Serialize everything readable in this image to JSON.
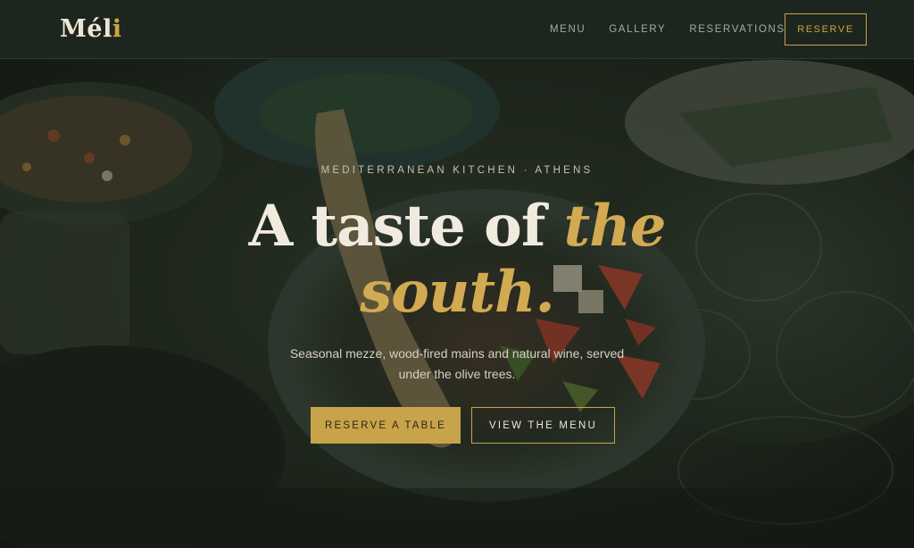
{
  "brand": {
    "logo_main": "Mél",
    "logo_accent": "i"
  },
  "nav": {
    "items": [
      {
        "label": "MENU"
      },
      {
        "label": "GALLERY"
      },
      {
        "label": "RESERVATIONS"
      }
    ],
    "reserve_label": "RESERVE"
  },
  "hero": {
    "eyebrow": "MEDITERRANEAN KITCHEN · ATHENS",
    "headline_plain": "A taste of ",
    "headline_accent_1": "the",
    "headline_accent_2": "south.",
    "subtitle": "Seasonal mezze, wood-fired mains and natural wine, served under the olive trees.",
    "primary_cta": "RESERVE A TABLE",
    "secondary_cta": "VIEW THE MENU"
  },
  "colors": {
    "accent": "#c9a34a",
    "header_bg": "#1d261e",
    "text_light": "#f0ebde"
  }
}
